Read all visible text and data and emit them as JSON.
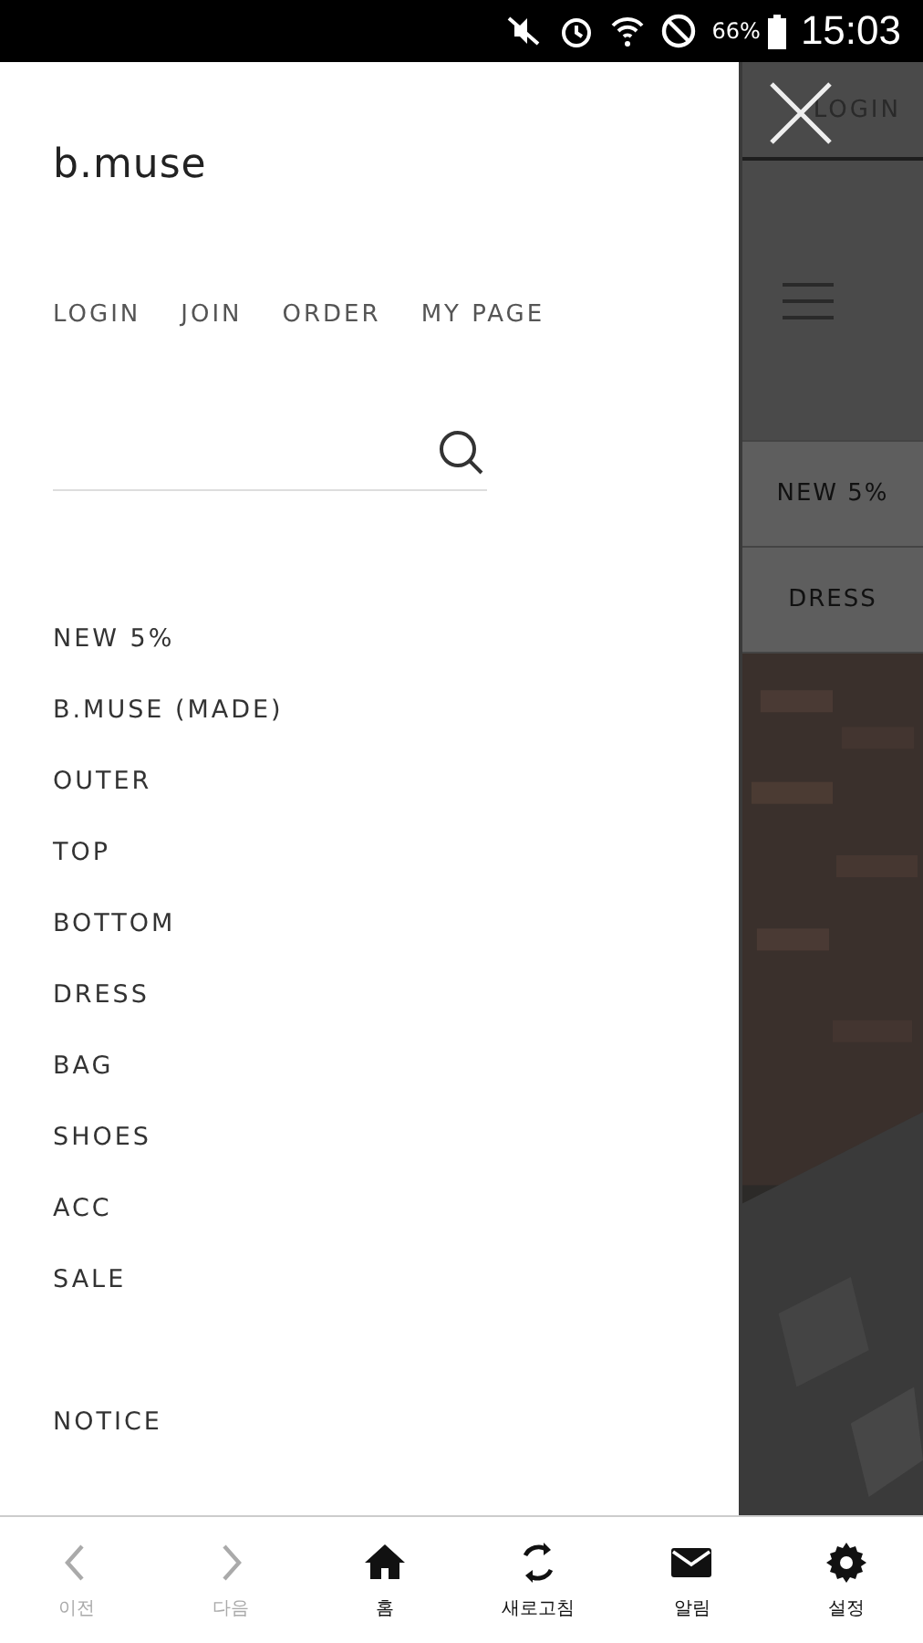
{
  "status_bar": {
    "battery": "66%",
    "time": "15:03"
  },
  "drawer": {
    "logo": "b.muse",
    "links": [
      "LOGIN",
      "JOIN",
      "ORDER",
      "MY PAGE"
    ],
    "categories": [
      "NEW 5%",
      "B.MUSE (MADE)",
      "OUTER",
      "TOP",
      "BOTTOM",
      "DRESS",
      "BAG",
      "SHOES",
      "ACC",
      "SALE"
    ],
    "extra": [
      "NOTICE"
    ]
  },
  "behind": {
    "login": "LOGIN",
    "menu": [
      "NEW 5%",
      "DRESS"
    ]
  },
  "bottom_nav": [
    {
      "kind": "back",
      "label": "이전",
      "disabled": true
    },
    {
      "kind": "forward",
      "label": "다음",
      "disabled": true
    },
    {
      "kind": "home",
      "label": "홈",
      "disabled": false
    },
    {
      "kind": "refresh",
      "label": "새로고침",
      "disabled": false
    },
    {
      "kind": "mail",
      "label": "알림",
      "disabled": false
    },
    {
      "kind": "settings",
      "label": "설정",
      "disabled": false
    }
  ]
}
